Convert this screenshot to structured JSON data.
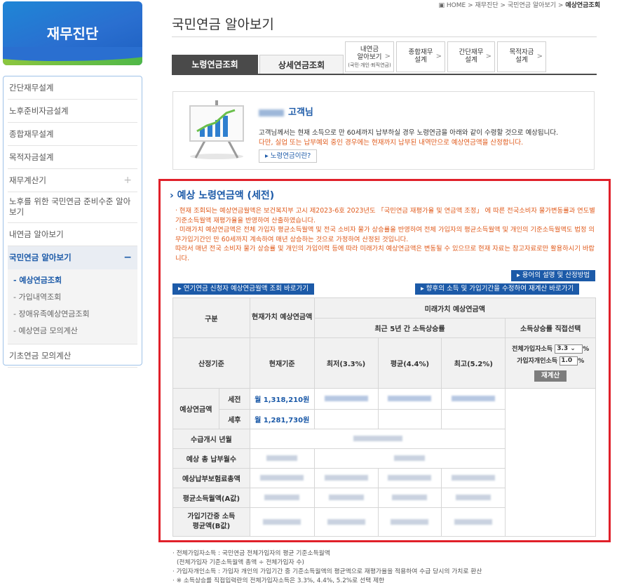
{
  "sidebar": {
    "title": "재무진단",
    "items": [
      {
        "label": "간단재무설계"
      },
      {
        "label": "노후준비자금설계"
      },
      {
        "label": "종합재무설계"
      },
      {
        "label": "목적자금설계"
      },
      {
        "label": "재무계산기",
        "toggle": "+"
      },
      {
        "label": "노후를 위한 국민연금 준비수준 알아보기"
      },
      {
        "label": "내연금 알아보기"
      },
      {
        "label": "국민연금 알아보기",
        "toggle": "−"
      },
      {
        "label": "기초연금 모의계산"
      }
    ],
    "sub_items": [
      {
        "label": "- 예상연금조회"
      },
      {
        "label": "- 가입내역조회"
      },
      {
        "label": "- 장애유족예상연금조회"
      },
      {
        "label": "- 예상연금 모의계산"
      }
    ]
  },
  "breadcrumb": {
    "home": "HOME",
    "sep": ">",
    "l1": "재무진단",
    "l2": "국민연금 알아보기",
    "current": "예상연금조회"
  },
  "page_title": "국민연금 알아보기",
  "tabs": {
    "main": [
      "노령연금조회",
      "상세연금조회"
    ],
    "mini": [
      {
        "line1": "내연금",
        "line2": "알아보기",
        "small": "(국민·개인·퇴직연금)"
      },
      {
        "line1": "종합재무",
        "line2": "설계"
      },
      {
        "line1": "간단재무",
        "line2": "설계"
      },
      {
        "line1": "목적자금",
        "line2": "설계"
      }
    ],
    "arrow": ">"
  },
  "info": {
    "customer_suffix": "고객님",
    "line1": "고객님께서는 현재 소득으로 만 60세까지 납부하실 경우 노령연금을 아래와 같이 수령할 것으로 예상됩니다.",
    "line2": "다만, 실업 또는 납부예외 중인 경우에는 현재까지 납부된 내역만으로 예상연금액을 산정합니다.",
    "button": "▸ 노령연금이란?"
  },
  "section": {
    "title": "› 예상 노령연금액 (세전)",
    "notice": [
      "· 현재 조회되는 예상연금월액은 보건복지부 고시 제2023-6호 2023년도 「국민연금 재평가율 및 연금액 조정」 에 따른 전국소비자 물가변동률과 연도별 기준소득월액 재평가율을 반영하여 산출하였습니다.",
      "· 미래가치 예상연금액은 전체 가입자 평균소득월액 및 전국 소비자 물가 상승률을 반영하여 전체 가입자의 평균소득월액 및 개인의 기준소득월액도 법정 의무가입기간인 만 60세까지 계속하여 매년 상승하는 것으로 가정하여 산정된 것입니다.",
      "따라서 매년 전국 소비자 물가 상승률 및 개인의 가입이력 등에 따라 미래가치 예상연금액은 변동될 수 있으므로 현재 자료는 참고자료로만 활용하시기 바랍니다."
    ],
    "btn_terms": "▸ 용어의 설명 및 산정방법",
    "btn_deferred": "▸ 연기연금 신청자 예상연금월액 조회 바로가기",
    "btn_recalc": "▸ 향후의 소득 및 가입기간을 수정하여 재계산 바로가기"
  },
  "table": {
    "h_category": "구분",
    "h_current": "현재가치 예상연금액",
    "h_future": "미래가치 예상연금액",
    "h_recent": "최근 5년 간 소득상승률",
    "h_direct": "소득상승률 직접선택",
    "h_basis": "산정기준",
    "h_current_basis": "현재기준",
    "h_low": "최저(3.3%)",
    "h_avg": "평균(4.4%)",
    "h_high": "최고(5.2%)",
    "direct_total_label": "전체가입자소득",
    "direct_total_value": "3.3",
    "direct_personal_label": "가입자개인소득",
    "direct_personal_value": "1.0",
    "pct": "%",
    "recalc_btn": "재계산",
    "row_pension": "예상연금액",
    "pretax": "세전",
    "aftertax": "세후",
    "pretax_value": "월 1,318,210원",
    "aftertax_value": "월 1,281,730원",
    "rows": [
      "수급개시 년월",
      "예상 총 납부월수",
      "예상납부보험료총액",
      "평균소득월액(A값)",
      "가입기간중 소득 평균액(B값)"
    ]
  },
  "footnotes": [
    "· 전체가입자소득 : 국민연금 전체가입자의 평균 기준소득월액",
    "(전체가입자 기준소득월액 총액 ÷ 전체가입자 수)",
    "· 가입자개인소득 : 가입자 개인의 가입기간 중 기준소득월액의 평균액으로 재평가율을 적용하여 수급 당시의 가치로 환산",
    "· ※ 소득상승률 직접입력란의 전체가입자소득은 3.3%, 4.4%, 5.2%로 선택 제한"
  ]
}
